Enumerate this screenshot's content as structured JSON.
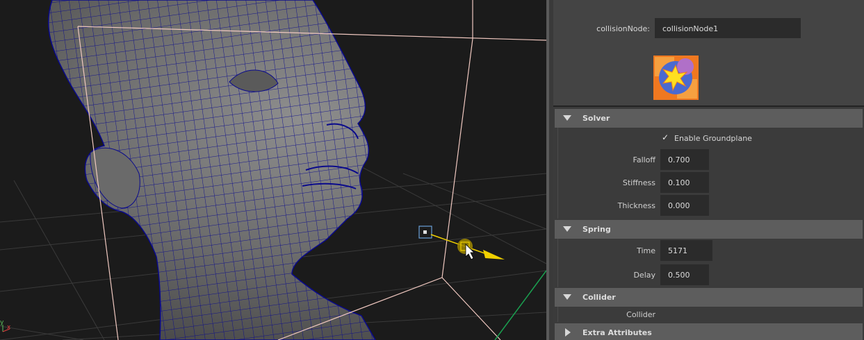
{
  "viewport": {
    "axis_labels": {
      "x": "x",
      "y": "y"
    }
  },
  "node": {
    "label": "collisionNode:",
    "value": "collisionNode1",
    "icon": "collision-node-icon"
  },
  "sections": {
    "solver": {
      "title": "Solver",
      "enable_groundplane": {
        "label": "Enable Groundplane",
        "checked": true
      },
      "falloff": {
        "label": "Falloff",
        "value": "0.700"
      },
      "stiffness": {
        "label": "Stiffness",
        "value": "0.100"
      },
      "thickness": {
        "label": "Thickness",
        "value": "0.000"
      }
    },
    "spring": {
      "title": "Spring",
      "time": {
        "label": "Time",
        "value": "5171"
      },
      "delay": {
        "label": "Delay",
        "value": "0.500"
      }
    },
    "collider": {
      "title": "Collider",
      "collider": {
        "label": "Collider"
      }
    },
    "extra": {
      "title": "Extra Attributes"
    }
  },
  "colors": {
    "wire": "#0a0a8c",
    "bbox": "#f0c8c0",
    "gizmo": "#f0d000",
    "icon_orange": "#f07820",
    "icon_blue": "#4a6ad0"
  }
}
